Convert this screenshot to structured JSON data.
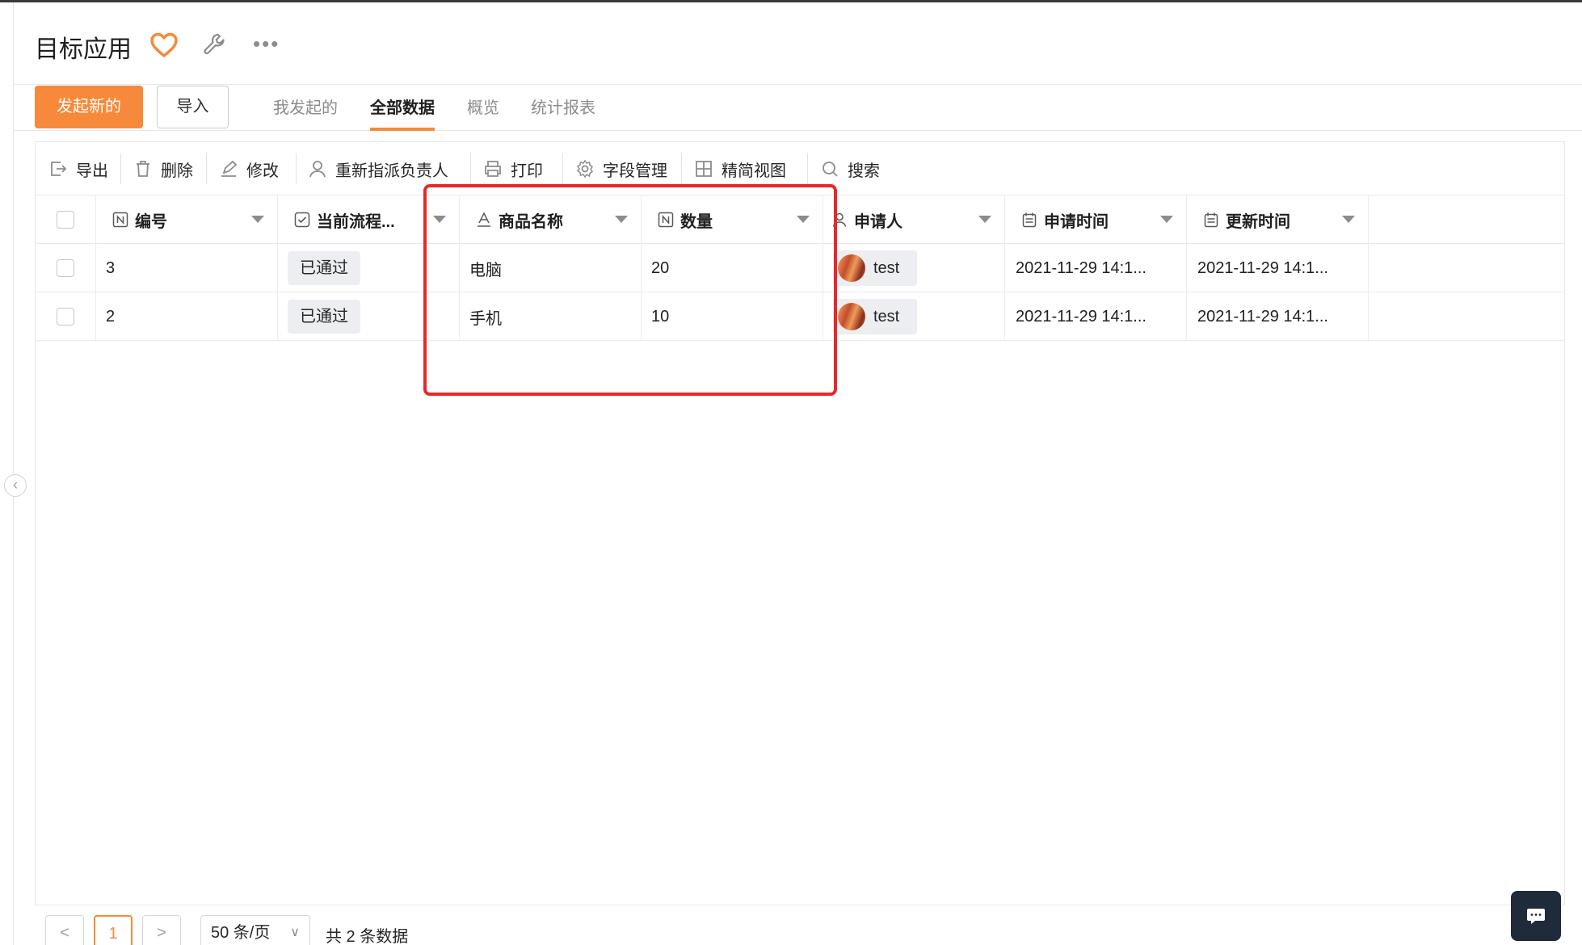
{
  "app": {
    "title": "目标应用",
    "colors": {
      "accent": "#f7893a",
      "highlight": "#e8282b"
    }
  },
  "header_icons": [
    "heart-icon",
    "wrench-icon",
    "more-icon"
  ],
  "more_glyph": "•••",
  "actions": {
    "new_label": "发起新的",
    "import_label": "导入"
  },
  "tabs": [
    {
      "label": "我发起的",
      "active": false
    },
    {
      "label": "全部数据",
      "active": true
    },
    {
      "label": "概览",
      "active": false
    },
    {
      "label": "统计报表",
      "active": false
    }
  ],
  "toolbar": {
    "export": "导出",
    "delete": "删除",
    "edit": "修改",
    "reassign": "重新指派负责人",
    "print": "打印",
    "fields": "字段管理",
    "compact_view": "精简视图",
    "search": "搜索"
  },
  "table": {
    "columns": [
      {
        "label": "编号",
        "icon": "number-field-icon"
      },
      {
        "label": "当前流程...",
        "icon": "checkbox-field-icon"
      },
      {
        "label": "商品名称",
        "icon": "text-field-icon"
      },
      {
        "label": "数量",
        "icon": "number-field-icon"
      },
      {
        "label": "申请人",
        "icon": "user-field-icon"
      },
      {
        "label": "申请时间",
        "icon": "date-field-icon"
      },
      {
        "label": "更新时间",
        "icon": "date-field-icon"
      }
    ],
    "rows": [
      {
        "id": "3",
        "status": "已通过",
        "product": "电脑",
        "quantity": "20",
        "applicant": "test",
        "applied_at": "2021-11-29 14:1...",
        "updated_at": "2021-11-29 14:1..."
      },
      {
        "id": "2",
        "status": "已通过",
        "product": "手机",
        "quantity": "10",
        "applicant": "test",
        "applied_at": "2021-11-29 14:1...",
        "updated_at": "2021-11-29 14:1..."
      }
    ]
  },
  "pagination": {
    "prev": "<",
    "current_page": "1",
    "next": ">",
    "page_size": "50 条/页",
    "page_size_chevron": "∨",
    "total": "共 2 条数据"
  },
  "collapse_glyph": "‹"
}
